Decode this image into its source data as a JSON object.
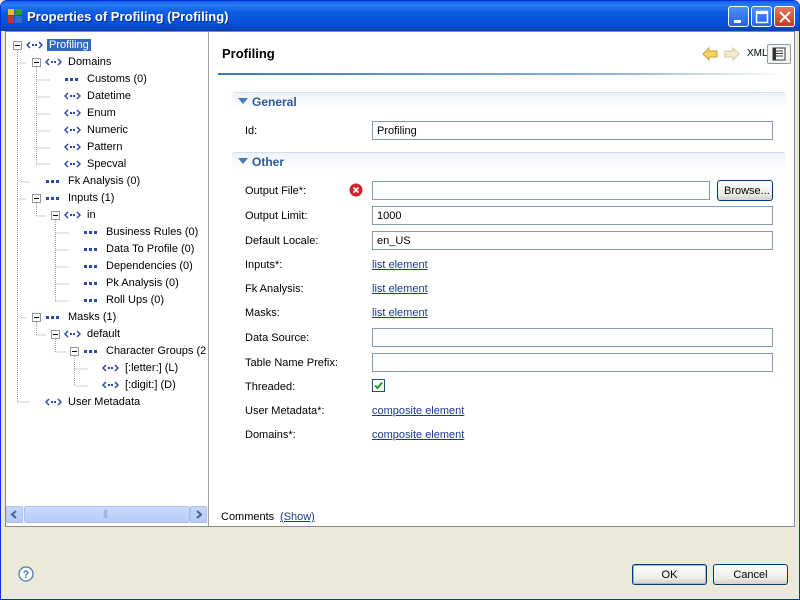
{
  "window": {
    "title": "Properties of Profiling (Profiling)",
    "controls": [
      "minimize-icon",
      "maximize-icon",
      "close-icon"
    ]
  },
  "tree": {
    "nodes": [
      {
        "label": "Profiling",
        "icon": "composite-node-icon",
        "selected": true,
        "expanded": true
      },
      {
        "label": "Domains",
        "icon": "composite-node-icon",
        "expanded": true
      },
      {
        "label": "Customs (0)",
        "icon": "list-node-icon"
      },
      {
        "label": "Datetime",
        "icon": "composite-node-icon"
      },
      {
        "label": "Enum",
        "icon": "composite-node-icon"
      },
      {
        "label": "Numeric",
        "icon": "composite-node-icon"
      },
      {
        "label": "Pattern",
        "icon": "composite-node-icon"
      },
      {
        "label": "Specval",
        "icon": "composite-node-icon"
      },
      {
        "label": "Fk Analysis (0)",
        "icon": "list-node-icon"
      },
      {
        "label": "Inputs (1)",
        "icon": "list-node-icon",
        "expanded": true
      },
      {
        "label": "in",
        "icon": "composite-node-icon",
        "expanded": true
      },
      {
        "label": "Business Rules (0)",
        "icon": "list-node-icon"
      },
      {
        "label": "Data To Profile (0)",
        "icon": "list-node-icon"
      },
      {
        "label": "Dependencies (0)",
        "icon": "list-node-icon"
      },
      {
        "label": "Pk Analysis (0)",
        "icon": "list-node-icon"
      },
      {
        "label": "Roll Ups (0)",
        "icon": "list-node-icon"
      },
      {
        "label": "Masks (1)",
        "icon": "list-node-icon",
        "expanded": true
      },
      {
        "label": "default",
        "icon": "composite-node-icon",
        "expanded": true
      },
      {
        "label": "Character Groups (2",
        "icon": "list-node-icon",
        "expanded": true
      },
      {
        "label": "[:letter:] (L)",
        "icon": "composite-node-icon"
      },
      {
        "label": "[:digit:] (D)",
        "icon": "composite-node-icon"
      },
      {
        "label": "User Metadata",
        "icon": "composite-node-icon"
      }
    ],
    "scrollbar_thumb_label": "|||"
  },
  "form": {
    "title": "Profiling",
    "toolbar": {
      "back_icon": "arrow-left-icon",
      "forward_icon": "arrow-right-icon",
      "xml_label": "XML",
      "view_toggle_icon": "form-view-icon"
    },
    "sections": {
      "general": {
        "title": "General"
      },
      "other": {
        "title": "Other"
      }
    },
    "fields": {
      "id": {
        "label": "Id:",
        "value": "Profiling"
      },
      "output_file": {
        "label": "Output File*:",
        "value": "",
        "browse_label": "Browse...",
        "status_icon": "error-icon"
      },
      "output_limit": {
        "label": "Output Limit:",
        "value": "1000"
      },
      "default_locale": {
        "label": "Default Locale:",
        "value": "en_US"
      },
      "inputs": {
        "label": "Inputs*:",
        "link": "list element"
      },
      "fk_analysis": {
        "label": "Fk Analysis:",
        "link": "list element"
      },
      "masks": {
        "label": "Masks:",
        "link": "list element"
      },
      "data_source": {
        "label": "Data Source:",
        "value": ""
      },
      "table_name_prefix": {
        "label": "Table Name Prefix:",
        "value": ""
      },
      "threaded": {
        "label": "Threaded:",
        "checked": true
      },
      "user_metadata": {
        "label": "User Metadata*:",
        "link": "composite element"
      },
      "domains": {
        "label": "Domains*:",
        "link": "composite element"
      }
    },
    "comments": {
      "label": "Comments",
      "link": "(Show)"
    }
  },
  "buttons": {
    "help_icon": "help-icon",
    "ok": "OK",
    "cancel": "Cancel"
  },
  "colors": {
    "titlebar": "#0653db",
    "selection": "#316ac5",
    "section_title": "#2a5a9a",
    "link": "#1a3a8c",
    "error": "#d4202a"
  }
}
